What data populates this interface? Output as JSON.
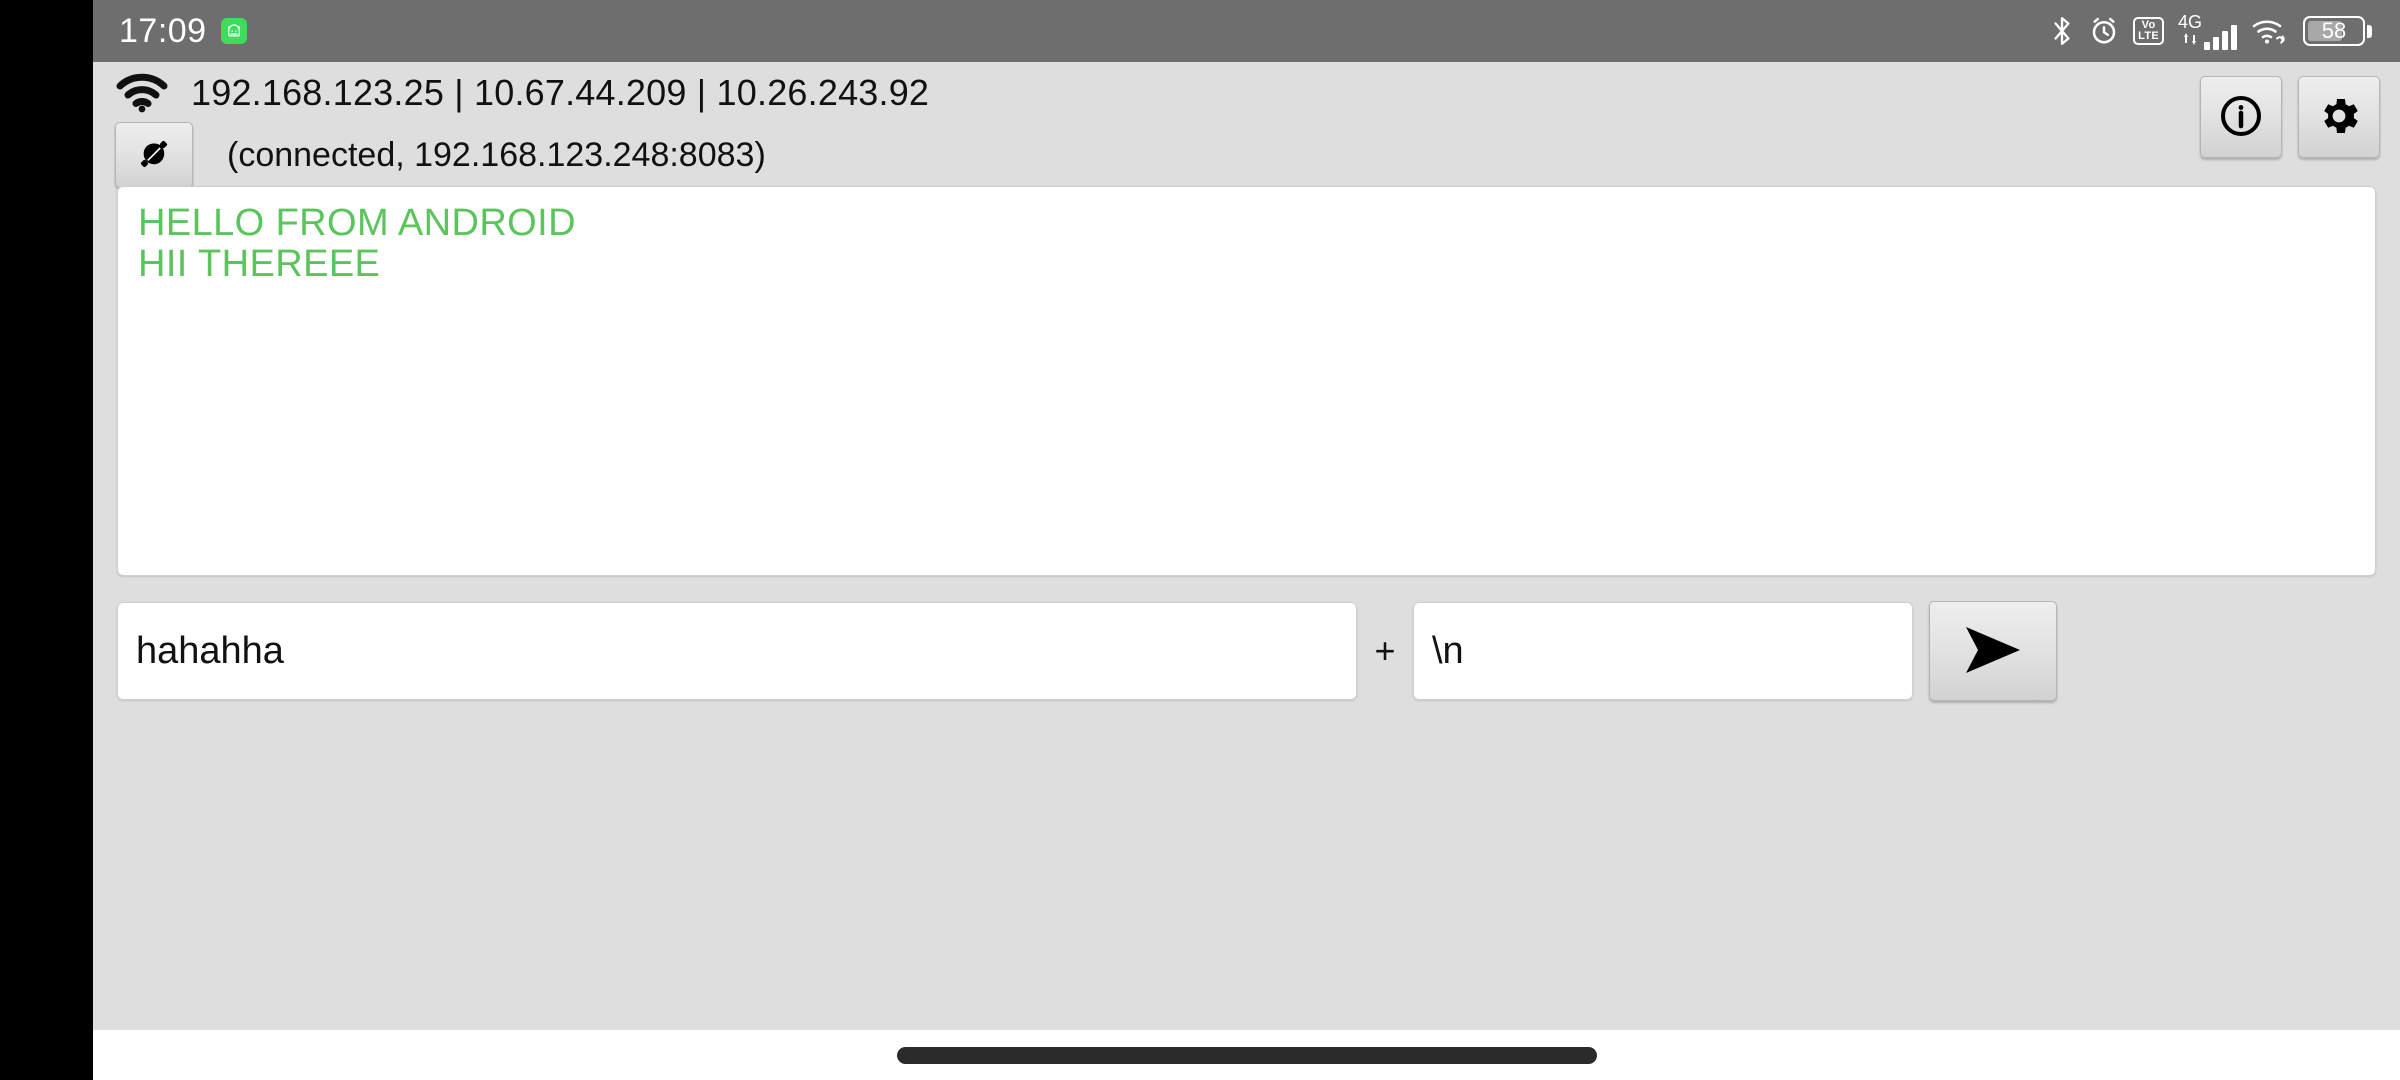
{
  "statusbar": {
    "clock": "17:09",
    "app_badge_icon": "android-robot-icon",
    "icons": [
      "bluetooth-icon",
      "alarm-icon",
      "volte-icon",
      "mobile-data-icon",
      "signal-bars-icon",
      "wifi-link-icon"
    ],
    "volte_top": "Vo",
    "volte_bottom": "LTE",
    "network_type": "4G",
    "battery_level": "58",
    "colors": {
      "bar_bg": "#6e6e6e",
      "badge_green": "#3ddc5b"
    }
  },
  "header": {
    "wifi_icon": "wifi-icon",
    "ip_addresses": "192.168.123.25 | 10.67.44.209 | 10.26.243.92",
    "connect_button_icon": "plug-connector-icon",
    "connection_status": "(connected, 192.168.123.248:8083)",
    "info_button_icon": "info-circle-icon",
    "settings_button_icon": "gear-icon"
  },
  "log": {
    "text_color": "#5cc45c",
    "lines": [
      "HELLO FROM ANDROID",
      "HII THEREEE"
    ]
  },
  "input": {
    "message_value": "hahahha",
    "message_placeholder": "",
    "separator": "+",
    "suffix_value": "\\n",
    "suffix_placeholder": "",
    "send_button_icon": "send-arrow-icon"
  },
  "navigation": {
    "gesture_pill": "home-gesture-pill"
  }
}
